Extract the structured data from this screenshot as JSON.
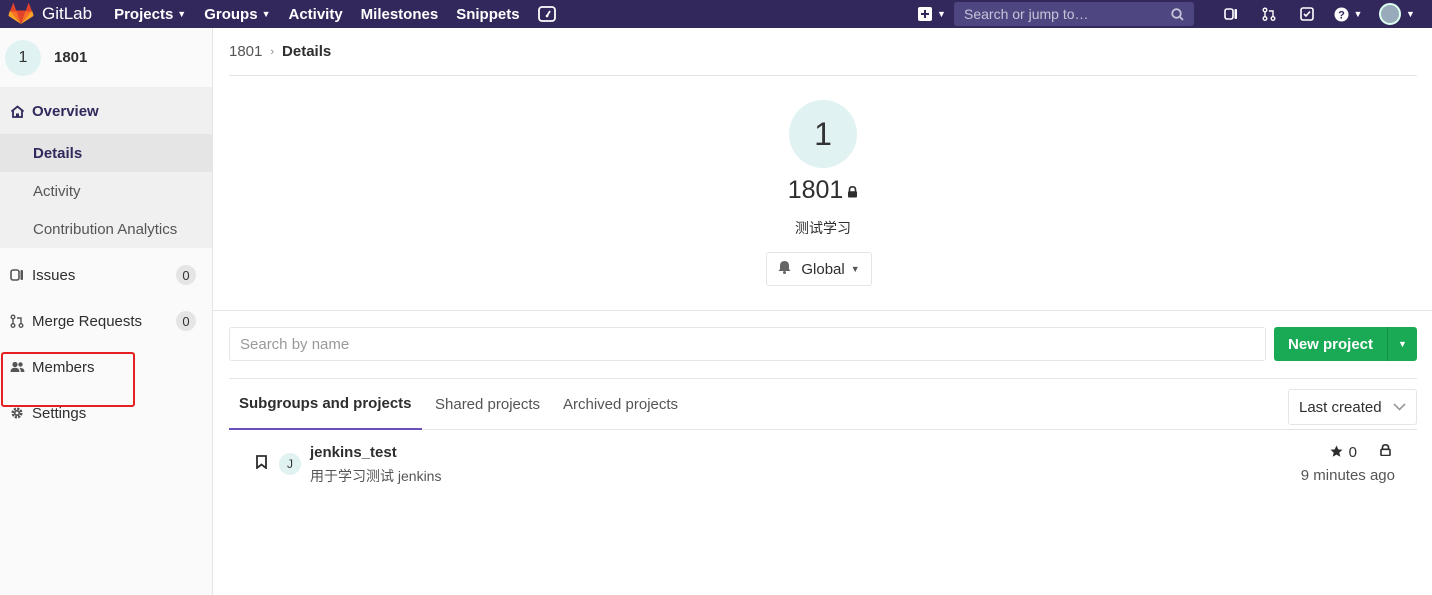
{
  "topnav": {
    "app_name": "GitLab",
    "links": [
      {
        "label": "Projects",
        "has_caret": true
      },
      {
        "label": "Groups",
        "has_caret": true
      },
      {
        "label": "Activity",
        "has_caret": false
      },
      {
        "label": "Milestones",
        "has_caret": false
      },
      {
        "label": "Snippets",
        "has_caret": false
      }
    ],
    "search_placeholder": "Search or jump to…",
    "brand_color": "#32285c"
  },
  "sidebar": {
    "group_avatar": "1",
    "group_name": "1801",
    "overview_label": "Overview",
    "sub_items": [
      {
        "label": "Details",
        "active": true
      },
      {
        "label": "Activity",
        "active": false
      },
      {
        "label": "Contribution Analytics",
        "active": false
      }
    ],
    "issues_label": "Issues",
    "issues_count": "0",
    "mr_label": "Merge Requests",
    "mr_count": "0",
    "members_label": "Members",
    "settings_label": "Settings"
  },
  "breadcrumb": {
    "parent": "1801",
    "current": "Details"
  },
  "group": {
    "avatar_letter": "1",
    "name": "1801",
    "description": "测试学习",
    "notification_level": "Global"
  },
  "filter": {
    "search_placeholder": "Search by name",
    "new_project_label": "New project"
  },
  "tabs": [
    {
      "label": "Subgroups and projects",
      "active": true
    },
    {
      "label": "Shared projects",
      "active": false
    },
    {
      "label": "Archived projects",
      "active": false
    }
  ],
  "sort_label": "Last created",
  "projects": [
    {
      "avatar_letter": "J",
      "name": "jenkins_test",
      "description": "用于学习测试 jenkins",
      "stars": "0",
      "updated": "9 minutes ago"
    }
  ],
  "accent_color": "#6b4fbb",
  "success_color": "#1aaa55",
  "annotation_color": "#e52020"
}
